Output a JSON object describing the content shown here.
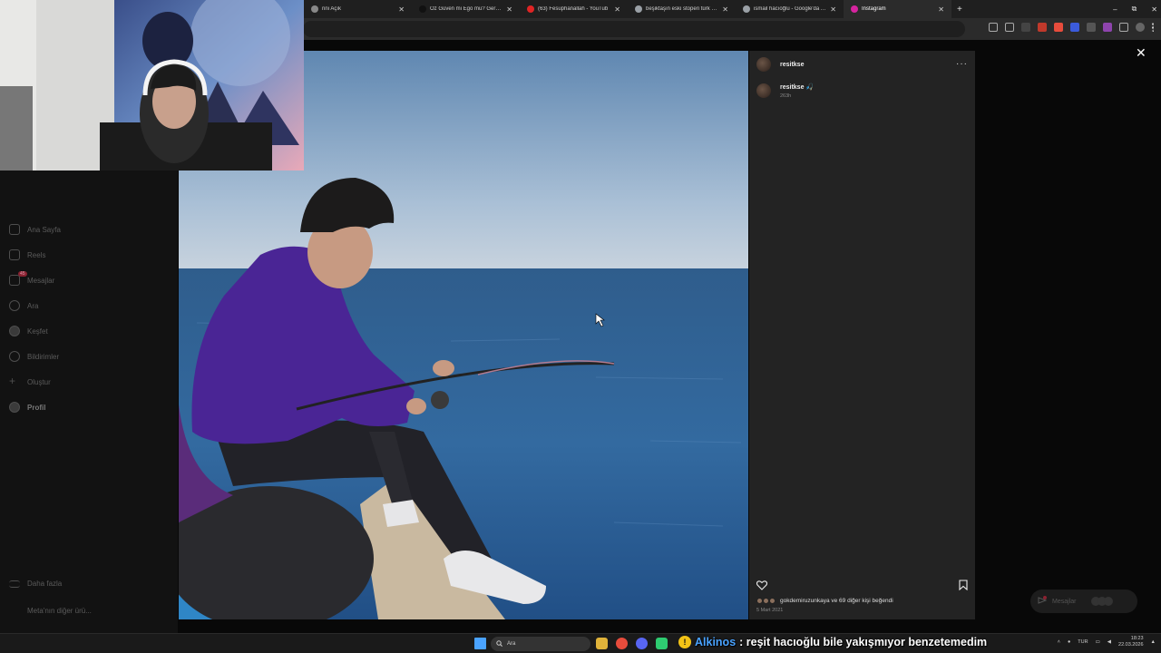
{
  "browser": {
    "tabs": [
      {
        "title": "rini Açık",
        "favicon_color": "#888888",
        "active": false
      },
      {
        "title": "Öz Güven mi Ego mu? Gerçek Y",
        "favicon_color": "#111111",
        "active": false
      },
      {
        "title": "(63) Fesuphanallah - YouTub",
        "favicon_color": "#e02424",
        "active": false
      },
      {
        "title": "beşiktaşın eski stoperi türk - Gö",
        "favicon_color": "#9aa0a6",
        "active": false
      },
      {
        "title": "ismail hacıoğlu - Google'da Ara",
        "favicon_color": "#9aa0a6",
        "active": false
      },
      {
        "title": "Instagram",
        "favicon_color": "#d6249f",
        "active": true
      }
    ],
    "new_tab_label": "+",
    "window_controls": [
      "–",
      "⧉",
      "✕"
    ]
  },
  "sidebar": {
    "items": [
      {
        "label": "Ana Sayfa",
        "icon": "home-icon"
      },
      {
        "label": "Reels",
        "icon": "reels-icon"
      },
      {
        "label": "Mesajlar",
        "icon": "messages-icon",
        "badge": "45"
      },
      {
        "label": "Ara",
        "icon": "search-icon"
      },
      {
        "label": "Keşfet",
        "icon": "explore-icon"
      },
      {
        "label": "Bildirimler",
        "icon": "heart-icon"
      },
      {
        "label": "Oluştur",
        "icon": "plus-icon"
      },
      {
        "label": "Profil",
        "icon": "avatar-icon"
      }
    ],
    "bottom": [
      {
        "label": "Daha fazla",
        "icon": "menu-icon"
      },
      {
        "label": "Meta'nın diğer ürü...",
        "icon": "meta-icon"
      }
    ]
  },
  "post": {
    "username": "resitkse",
    "more_label": "···",
    "caption_user": "resitkse",
    "caption_emoji": "🎣",
    "caption_time": "263h",
    "likes_text": "gokdemiruzunkaya ve 69 diğer kişi beğendi",
    "date": "5 Mart 2021"
  },
  "messages_pill": {
    "label": "Mesajlar"
  },
  "close_label": "✕",
  "taskbar": {
    "search_placeholder": "Ara",
    "tray_lang": "TUR",
    "time": "18:23",
    "date": "22.03.2026"
  },
  "chat_overlay": {
    "badge": "!",
    "user": "Alkinos",
    "message": ": reşit hacıoğlu bile yakışmıyor benzetemedim"
  },
  "colors": {
    "instagram_accent": "#d6249f",
    "youtube_red": "#e02424",
    "chat_user": "#4aa3ff",
    "badge_yellow": "#f3c316"
  }
}
